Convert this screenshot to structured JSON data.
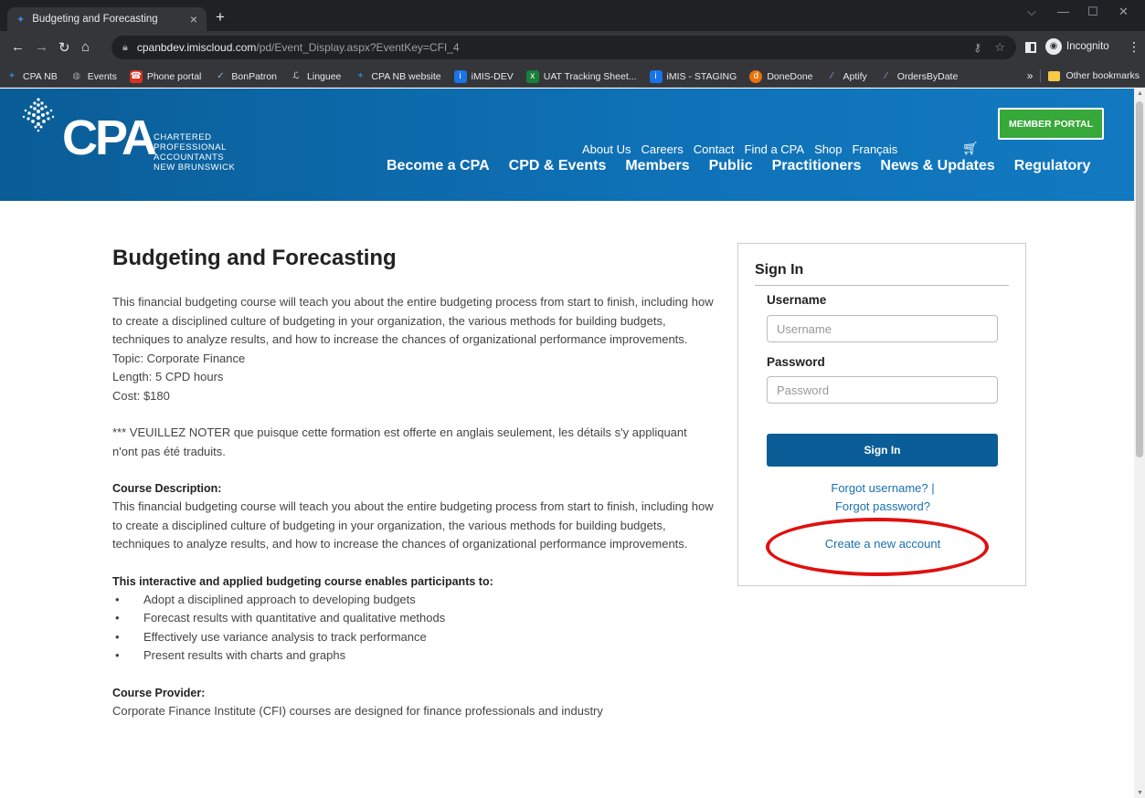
{
  "browser": {
    "tab_title": "Budgeting and Forecasting",
    "url_host": "cpanbdev.imiscloud.com",
    "url_path": "/pd/Event_Display.aspx?EventKey=CFI_4",
    "incognito_label": "Incognito",
    "bookmarks": [
      {
        "label": "CPA NB",
        "icon": "maple-leaf-icon",
        "color": "#2b7bc0"
      },
      {
        "label": "Events",
        "icon": "globe-icon",
        "color": "#5f6368"
      },
      {
        "label": "Phone portal",
        "icon": "phone-icon",
        "color": "#d93025"
      },
      {
        "label": "BonPatron",
        "icon": "check-icon",
        "color": "#6aa84f"
      },
      {
        "label": "Linguee",
        "icon": "linguee-icon",
        "color": "#5f6368"
      },
      {
        "label": "CPA NB website",
        "icon": "maple-leaf-icon",
        "color": "#2b7bc0"
      },
      {
        "label": "iMIS-DEV",
        "icon": "imis-icon",
        "color": "#1a73e8"
      },
      {
        "label": "UAT Tracking Sheet...",
        "icon": "excel-icon",
        "color": "#188038"
      },
      {
        "label": "iMIS - STAGING",
        "icon": "imis-icon",
        "color": "#1a73e8"
      },
      {
        "label": "DoneDone",
        "icon": "donedone-icon",
        "color": "#e8710a"
      },
      {
        "label": "Aptify",
        "icon": "aptify-icon",
        "color": "#8a2be2"
      },
      {
        "label": "OrdersByDate",
        "icon": "aptify-icon",
        "color": "#8a2be2"
      }
    ],
    "other_bookmarks": "Other bookmarks"
  },
  "header": {
    "logo_text": "CPA",
    "logo_sub": [
      "CHARTERED",
      "PROFESSIONAL",
      "ACCOUNTANTS",
      "NEW BRUNSWICK"
    ],
    "top_links": [
      "About Us",
      "Careers",
      "Contact",
      "Find a CPA",
      "Shop",
      "Français"
    ],
    "member_portal": "MEMBER PORTAL",
    "main_nav": [
      "Become a CPA",
      "CPD & Events",
      "Members",
      "Public",
      "Practitioners",
      "News & Updates",
      "Regulatory"
    ]
  },
  "content": {
    "title": "Budgeting and Forecasting",
    "intro": "This financial budgeting course will teach you about the entire budgeting process from start to finish, including how to create a disciplined culture of budgeting in your organization, the various methods for building budgets, techniques to analyze results, and how to increase the chances of organizational performance improvements.",
    "topic": "Topic: Corporate Finance",
    "length": "Length: 5 CPD hours",
    "cost": "Cost: $180",
    "note": "*** VEUILLEZ NOTER que puisque cette formation est offerte en anglais seulement, les détails s'y appliquant n'ont pas été traduits.",
    "desc_label": "Course Description:",
    "desc": "This financial budgeting course will teach you about the entire budgeting process from start to finish, including how to create a disciplined culture of budgeting in your organization, the various methods for building budgets, techniques to analyze results, and how to increase the chances of organizational performance improvements.",
    "enables_label": "This interactive and applied budgeting course enables participants to:",
    "bullets": [
      "Adopt a disciplined approach to developing budgets",
      "Forecast results with quantitative and qualitative methods",
      "Effectively use variance analysis to track performance",
      "Present results with charts and graphs"
    ],
    "provider_label": "Course Provider:",
    "provider": "Corporate Finance Institute (CFI) courses are designed for finance professionals and industry"
  },
  "signin": {
    "title": "Sign In",
    "username_label": "Username",
    "username_placeholder": "Username",
    "password_label": "Password",
    "password_placeholder": "Password",
    "button": "Sign In",
    "forgot_username": "Forgot username? |",
    "forgot_password": "Forgot password?",
    "create_account": "Create a new account"
  },
  "colors": {
    "header_blue": "#0f72b8",
    "member_green": "#37a83a",
    "signin_button": "#0a5d97",
    "highlight_red": "#e01010",
    "link": "#1a6fb0"
  }
}
